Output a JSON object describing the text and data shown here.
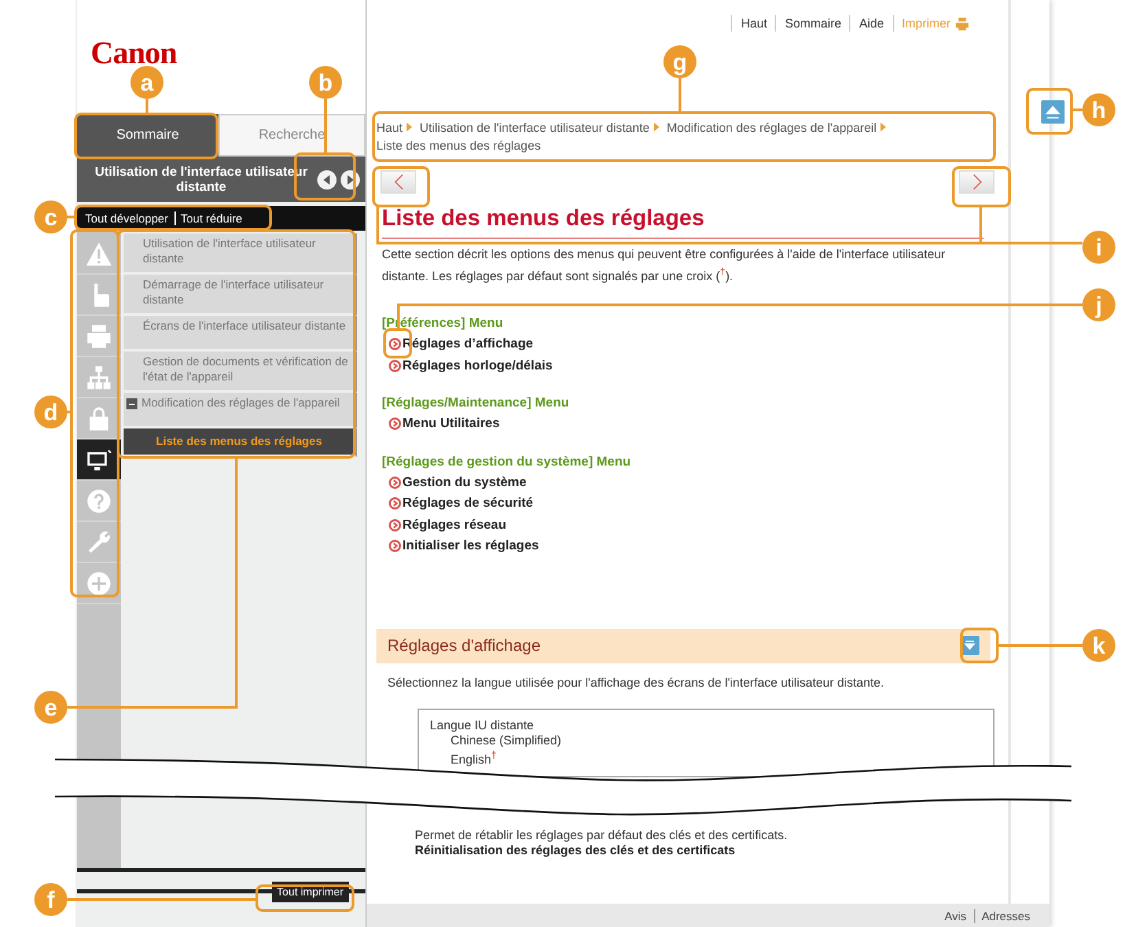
{
  "header_links": [
    {
      "label": "Haut",
      "kind": "link"
    },
    {
      "label": "Sommaire",
      "kind": "link"
    },
    {
      "label": "Aide",
      "kind": "link"
    },
    {
      "label": "Imprimer",
      "kind": "print"
    }
  ],
  "logo": "Canon",
  "tabs": [
    {
      "label": "Sommaire",
      "selected": true
    },
    {
      "label": "Recherche",
      "selected": false
    }
  ],
  "chapter_title": "Utilisation de l'interface utilisateur distante",
  "tree_controls": [
    "Tout développer",
    "Tout réduire"
  ],
  "chapter_icons": [
    {
      "kind": "warning",
      "selected": false
    },
    {
      "kind": "hand",
      "selected": false
    },
    {
      "kind": "printer",
      "selected": false
    },
    {
      "kind": "network",
      "selected": false
    },
    {
      "kind": "lock",
      "selected": false
    },
    {
      "kind": "monitor",
      "selected": true
    },
    {
      "kind": "help",
      "selected": false
    },
    {
      "kind": "wrench",
      "selected": false
    },
    {
      "kind": "plus",
      "selected": false
    }
  ],
  "tree_items": [
    {
      "label": "Utilisation de l'interface utilisateur distante",
      "selected": false
    },
    {
      "label": "Démarrage de l'interface utilisateur distante",
      "selected": false
    },
    {
      "label": "Écrans de l'interface utilisateur distante",
      "selected": false
    },
    {
      "label": "Gestion de documents et vérification de l'état de l'appareil",
      "selected": false
    },
    {
      "label": "Modification des réglages de l'appareil",
      "selected": false,
      "expanded": true,
      "children": [
        {
          "label": "Liste des menus des réglages",
          "selected": true
        }
      ]
    }
  ],
  "print_all_button": "Tout imprimer",
  "breadcrumb": [
    "Haut",
    "Utilisation de l'interface utilisateur distante",
    "Modification des réglages de l'appareil",
    "Liste des menus des réglages"
  ],
  "page_title": "Liste des menus des réglages",
  "intro": "Cette section décrit les options des menus qui peuvent être configurées à l'aide de l'interface utilisateur distante. Les réglages par défaut sont signalés par une croix ($^{†}$).",
  "menus": [
    {
      "heading": "[Préférences] Menu",
      "links": [
        "Réglages d’affichage",
        "Réglages horloge/délais"
      ]
    },
    {
      "heading": "[Réglages/Maintenance] Menu",
      "links": [
        "Menu Utilitaires"
      ]
    },
    {
      "heading": "[Réglages de gestion du système] Menu",
      "links": [
        "Gestion du système",
        "Réglages de sécurité",
        "Réglages réseau",
        "Initialiser les réglages"
      ]
    }
  ],
  "section": {
    "title": "Réglages d'affichage",
    "description": "Sélectionnez la langue utilisée pour l'affichage des écrans de l'interface utilisateur distante.",
    "table_title": "Langue IU distante",
    "options": [
      "Chinese (Simplified)",
      "English$^{†}$"
    ]
  },
  "final_text": "Permet de rétablir les réglages par défaut des clés et des certificats.",
  "final_link": "Réinitialisation des réglages des clés et des certificats",
  "footer_links": [
    "Avis",
    "Adresses"
  ],
  "callouts": [
    "a",
    "b",
    "c",
    "d",
    "e",
    "f",
    "g",
    "h",
    "i",
    "j",
    "k"
  ]
}
